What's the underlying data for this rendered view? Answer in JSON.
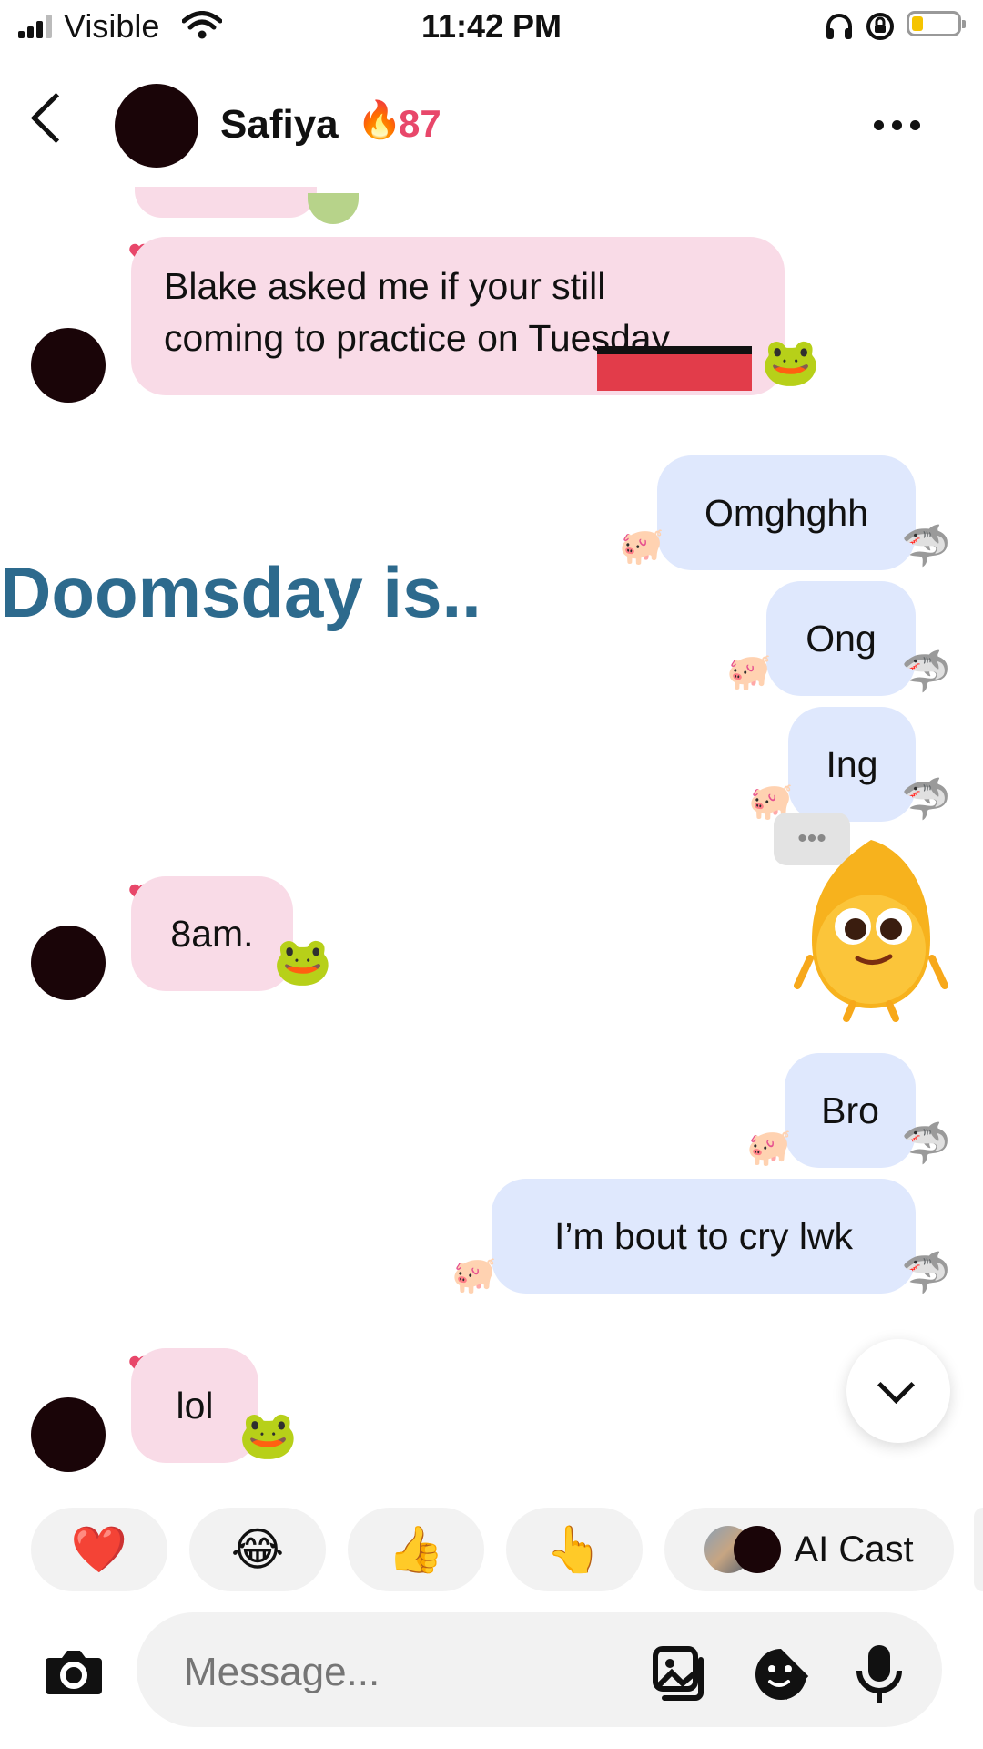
{
  "status_bar": {
    "carrier": "Visible",
    "time": "11:42 PM"
  },
  "header": {
    "name": "Safiya",
    "streak_icon": "🔥",
    "streak_count": "87"
  },
  "overlay_text": "Doomsday is..",
  "messages": [
    {
      "side": "in",
      "text_line1": "Blake asked me if your still",
      "text_line2": "coming to practice on Tuesday"
    },
    {
      "side": "out",
      "text": "Omghghh"
    },
    {
      "side": "out",
      "text": "Ong"
    },
    {
      "side": "out",
      "text": "Ing"
    },
    {
      "side": "in",
      "text": "8am."
    },
    {
      "side": "out",
      "text": "Bro"
    },
    {
      "side": "out",
      "text": "I’m bout to cry lwk"
    },
    {
      "side": "in",
      "text": "lol"
    }
  ],
  "typing_indicator": "•••",
  "quick_reactions": [
    "❤️",
    "😂",
    "👍",
    "👆"
  ],
  "ai_cast_label": "AI Cast",
  "composer": {
    "placeholder": "Message..."
  },
  "colors": {
    "incoming_bubble": "#f9dbe7",
    "outgoing_bubble": "#dfe8fd",
    "streak": "#e8476a",
    "overlay": "#2d6a8d",
    "redact": "#e23c4a"
  }
}
